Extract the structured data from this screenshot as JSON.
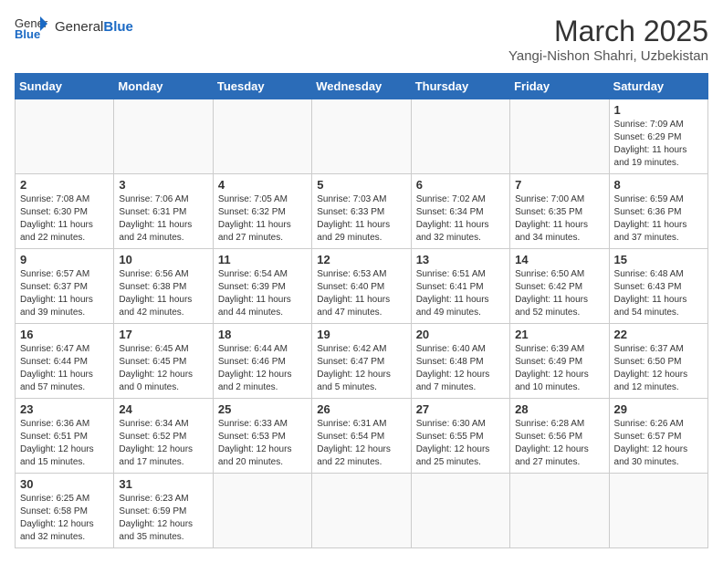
{
  "header": {
    "logo_general": "General",
    "logo_blue": "Blue",
    "month_year": "March 2025",
    "location": "Yangi-Nishon Shahri, Uzbekistan"
  },
  "weekdays": [
    "Sunday",
    "Monday",
    "Tuesday",
    "Wednesday",
    "Thursday",
    "Friday",
    "Saturday"
  ],
  "weeks": [
    [
      {
        "day": "",
        "info": ""
      },
      {
        "day": "",
        "info": ""
      },
      {
        "day": "",
        "info": ""
      },
      {
        "day": "",
        "info": ""
      },
      {
        "day": "",
        "info": ""
      },
      {
        "day": "",
        "info": ""
      },
      {
        "day": "1",
        "info": "Sunrise: 7:09 AM\nSunset: 6:29 PM\nDaylight: 11 hours and 19 minutes."
      }
    ],
    [
      {
        "day": "2",
        "info": "Sunrise: 7:08 AM\nSunset: 6:30 PM\nDaylight: 11 hours and 22 minutes."
      },
      {
        "day": "3",
        "info": "Sunrise: 7:06 AM\nSunset: 6:31 PM\nDaylight: 11 hours and 24 minutes."
      },
      {
        "day": "4",
        "info": "Sunrise: 7:05 AM\nSunset: 6:32 PM\nDaylight: 11 hours and 27 minutes."
      },
      {
        "day": "5",
        "info": "Sunrise: 7:03 AM\nSunset: 6:33 PM\nDaylight: 11 hours and 29 minutes."
      },
      {
        "day": "6",
        "info": "Sunrise: 7:02 AM\nSunset: 6:34 PM\nDaylight: 11 hours and 32 minutes."
      },
      {
        "day": "7",
        "info": "Sunrise: 7:00 AM\nSunset: 6:35 PM\nDaylight: 11 hours and 34 minutes."
      },
      {
        "day": "8",
        "info": "Sunrise: 6:59 AM\nSunset: 6:36 PM\nDaylight: 11 hours and 37 minutes."
      }
    ],
    [
      {
        "day": "9",
        "info": "Sunrise: 6:57 AM\nSunset: 6:37 PM\nDaylight: 11 hours and 39 minutes."
      },
      {
        "day": "10",
        "info": "Sunrise: 6:56 AM\nSunset: 6:38 PM\nDaylight: 11 hours and 42 minutes."
      },
      {
        "day": "11",
        "info": "Sunrise: 6:54 AM\nSunset: 6:39 PM\nDaylight: 11 hours and 44 minutes."
      },
      {
        "day": "12",
        "info": "Sunrise: 6:53 AM\nSunset: 6:40 PM\nDaylight: 11 hours and 47 minutes."
      },
      {
        "day": "13",
        "info": "Sunrise: 6:51 AM\nSunset: 6:41 PM\nDaylight: 11 hours and 49 minutes."
      },
      {
        "day": "14",
        "info": "Sunrise: 6:50 AM\nSunset: 6:42 PM\nDaylight: 11 hours and 52 minutes."
      },
      {
        "day": "15",
        "info": "Sunrise: 6:48 AM\nSunset: 6:43 PM\nDaylight: 11 hours and 54 minutes."
      }
    ],
    [
      {
        "day": "16",
        "info": "Sunrise: 6:47 AM\nSunset: 6:44 PM\nDaylight: 11 hours and 57 minutes."
      },
      {
        "day": "17",
        "info": "Sunrise: 6:45 AM\nSunset: 6:45 PM\nDaylight: 12 hours and 0 minutes."
      },
      {
        "day": "18",
        "info": "Sunrise: 6:44 AM\nSunset: 6:46 PM\nDaylight: 12 hours and 2 minutes."
      },
      {
        "day": "19",
        "info": "Sunrise: 6:42 AM\nSunset: 6:47 PM\nDaylight: 12 hours and 5 minutes."
      },
      {
        "day": "20",
        "info": "Sunrise: 6:40 AM\nSunset: 6:48 PM\nDaylight: 12 hours and 7 minutes."
      },
      {
        "day": "21",
        "info": "Sunrise: 6:39 AM\nSunset: 6:49 PM\nDaylight: 12 hours and 10 minutes."
      },
      {
        "day": "22",
        "info": "Sunrise: 6:37 AM\nSunset: 6:50 PM\nDaylight: 12 hours and 12 minutes."
      }
    ],
    [
      {
        "day": "23",
        "info": "Sunrise: 6:36 AM\nSunset: 6:51 PM\nDaylight: 12 hours and 15 minutes."
      },
      {
        "day": "24",
        "info": "Sunrise: 6:34 AM\nSunset: 6:52 PM\nDaylight: 12 hours and 17 minutes."
      },
      {
        "day": "25",
        "info": "Sunrise: 6:33 AM\nSunset: 6:53 PM\nDaylight: 12 hours and 20 minutes."
      },
      {
        "day": "26",
        "info": "Sunrise: 6:31 AM\nSunset: 6:54 PM\nDaylight: 12 hours and 22 minutes."
      },
      {
        "day": "27",
        "info": "Sunrise: 6:30 AM\nSunset: 6:55 PM\nDaylight: 12 hours and 25 minutes."
      },
      {
        "day": "28",
        "info": "Sunrise: 6:28 AM\nSunset: 6:56 PM\nDaylight: 12 hours and 27 minutes."
      },
      {
        "day": "29",
        "info": "Sunrise: 6:26 AM\nSunset: 6:57 PM\nDaylight: 12 hours and 30 minutes."
      }
    ],
    [
      {
        "day": "30",
        "info": "Sunrise: 6:25 AM\nSunset: 6:58 PM\nDaylight: 12 hours and 32 minutes."
      },
      {
        "day": "31",
        "info": "Sunrise: 6:23 AM\nSunset: 6:59 PM\nDaylight: 12 hours and 35 minutes."
      },
      {
        "day": "",
        "info": ""
      },
      {
        "day": "",
        "info": ""
      },
      {
        "day": "",
        "info": ""
      },
      {
        "day": "",
        "info": ""
      },
      {
        "day": "",
        "info": ""
      }
    ]
  ]
}
